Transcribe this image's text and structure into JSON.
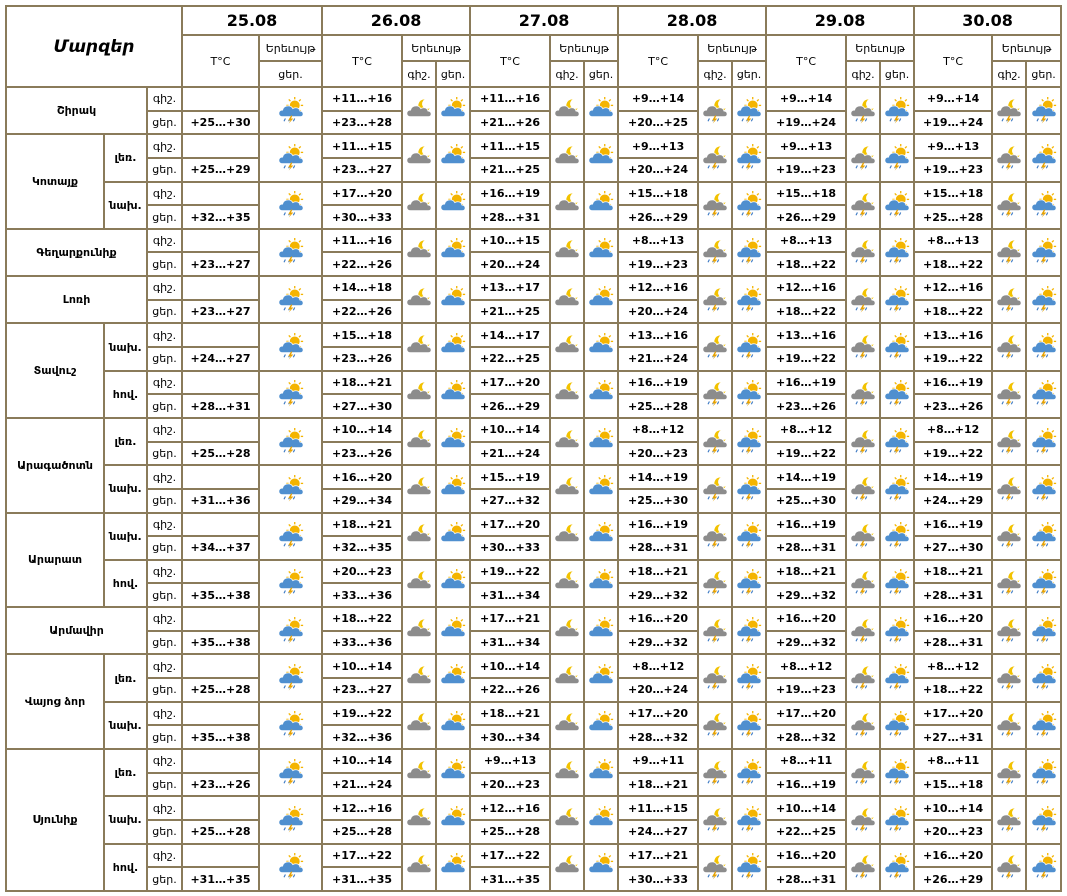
{
  "header": {
    "corner": "Մարզեր",
    "dates": [
      "25.08",
      "26.08",
      "27.08",
      "28.08",
      "29.08",
      "30.08"
    ],
    "temp_label": "T°C",
    "sky_label": "Երեւույթ",
    "night_label": "գիշ.",
    "day_label": "ցեր."
  },
  "regions": [
    {
      "name": "Շիրակ",
      "subs": [
        {
          "name": "",
          "night": [
            "",
            "+11…+16",
            "+11…+16",
            "+9…+14",
            "+9…+14",
            "+9…+14"
          ],
          "day": [
            "+25…+30",
            "+23…+28",
            "+21…+26",
            "+20…+25",
            "+19…+24",
            "+19…+24"
          ]
        }
      ]
    },
    {
      "name": "Կոտայք",
      "subs": [
        {
          "name": "լեռ.",
          "night": [
            "",
            "+11…+15",
            "+11…+15",
            "+9…+13",
            "+9…+13",
            "+9…+13"
          ],
          "day": [
            "+25…+29",
            "+23…+27",
            "+21…+25",
            "+20…+24",
            "+19…+23",
            "+19…+23"
          ]
        },
        {
          "name": "նախ.",
          "night": [
            "",
            "+17…+20",
            "+16…+19",
            "+15…+18",
            "+15…+18",
            "+15…+18"
          ],
          "day": [
            "+32…+35",
            "+30…+33",
            "+28…+31",
            "+26…+29",
            "+26…+29",
            "+25…+28"
          ]
        }
      ]
    },
    {
      "name": "Գեղարքունիք",
      "subs": [
        {
          "name": "",
          "night": [
            "",
            "+11…+16",
            "+10…+15",
            "+8…+13",
            "+8…+13",
            "+8…+13"
          ],
          "day": [
            "+23…+27",
            "+22…+26",
            "+20…+24",
            "+19…+23",
            "+18…+22",
            "+18…+22"
          ]
        }
      ]
    },
    {
      "name": "Լոռի",
      "subs": [
        {
          "name": "",
          "night": [
            "",
            "+14…+18",
            "+13…+17",
            "+12…+16",
            "+12…+16",
            "+12…+16"
          ],
          "day": [
            "+23…+27",
            "+22…+26",
            "+21…+25",
            "+20…+24",
            "+18…+22",
            "+18…+22"
          ]
        }
      ]
    },
    {
      "name": "Տավուշ",
      "subs": [
        {
          "name": "նախ.",
          "night": [
            "",
            "+15…+18",
            "+14…+17",
            "+13…+16",
            "+13…+16",
            "+13…+16"
          ],
          "day": [
            "+24…+27",
            "+23…+26",
            "+22…+25",
            "+21…+24",
            "+19…+22",
            "+19…+22"
          ]
        },
        {
          "name": "հով.",
          "night": [
            "",
            "+18…+21",
            "+17…+20",
            "+16…+19",
            "+16…+19",
            "+16…+19"
          ],
          "day": [
            "+28…+31",
            "+27…+30",
            "+26…+29",
            "+25…+28",
            "+23…+26",
            "+23…+26"
          ]
        }
      ]
    },
    {
      "name": "Արագածոտն",
      "subs": [
        {
          "name": "լեռ.",
          "night": [
            "",
            "+10…+14",
            "+10…+14",
            "+8…+12",
            "+8…+12",
            "+8…+12"
          ],
          "day": [
            "+25…+28",
            "+23…+26",
            "+21…+24",
            "+20…+23",
            "+19…+22",
            "+19…+22"
          ]
        },
        {
          "name": "նախ.",
          "night": [
            "",
            "+16…+20",
            "+15…+19",
            "+14…+19",
            "+14…+19",
            "+14…+19"
          ],
          "day": [
            "+31…+36",
            "+29…+34",
            "+27…+32",
            "+25…+30",
            "+25…+30",
            "+24…+29"
          ]
        }
      ]
    },
    {
      "name": "Արարատ",
      "subs": [
        {
          "name": "նախ.",
          "night": [
            "",
            "+18…+21",
            "+17…+20",
            "+16…+19",
            "+16…+19",
            "+16…+19"
          ],
          "day": [
            "+34…+37",
            "+32…+35",
            "+30…+33",
            "+28…+31",
            "+28…+31",
            "+27…+30"
          ]
        },
        {
          "name": "հով.",
          "night": [
            "",
            "+20…+23",
            "+19…+22",
            "+18…+21",
            "+18…+21",
            "+18…+21"
          ],
          "day": [
            "+35…+38",
            "+33…+36",
            "+31…+34",
            "+29…+32",
            "+29…+32",
            "+28…+31"
          ]
        }
      ]
    },
    {
      "name": "Արմավիր",
      "subs": [
        {
          "name": "",
          "night": [
            "",
            "+18…+22",
            "+17…+21",
            "+16…+20",
            "+16…+20",
            "+16…+20"
          ],
          "day": [
            "+35…+38",
            "+33…+36",
            "+31…+34",
            "+29…+32",
            "+29…+32",
            "+28…+31"
          ]
        }
      ]
    },
    {
      "name": "Վայոց ձոր",
      "subs": [
        {
          "name": "լեռ.",
          "night": [
            "",
            "+10…+14",
            "+10…+14",
            "+8…+12",
            "+8…+12",
            "+8…+12"
          ],
          "day": [
            "+25…+28",
            "+23…+27",
            "+22…+26",
            "+20…+24",
            "+19…+23",
            "+18…+22"
          ]
        },
        {
          "name": "նախ.",
          "night": [
            "",
            "+19…+22",
            "+18…+21",
            "+17…+20",
            "+17…+20",
            "+17…+20"
          ],
          "day": [
            "+35…+38",
            "+32…+36",
            "+30…+34",
            "+28…+32",
            "+28…+32",
            "+27…+31"
          ]
        }
      ]
    },
    {
      "name": "Սյունիք",
      "subs": [
        {
          "name": "լեռ.",
          "night": [
            "",
            "+10…+14",
            "+9…+13",
            "+9…+11",
            "+8…+11",
            "+8…+11"
          ],
          "day": [
            "+23…+26",
            "+21…+24",
            "+20…+23",
            "+18…+21",
            "+16…+19",
            "+15…+18"
          ]
        },
        {
          "name": "նախ.",
          "night": [
            "",
            "+12…+16",
            "+12…+16",
            "+11…+15",
            "+10…+14",
            "+10…+14"
          ],
          "day": [
            "+25…+28",
            "+25…+28",
            "+25…+28",
            "+24…+27",
            "+22…+25",
            "+20…+23"
          ]
        },
        {
          "name": "հով.",
          "night": [
            "",
            "+17…+22",
            "+17…+22",
            "+17…+21",
            "+16…+20",
            "+16…+20"
          ],
          "day": [
            "+31…+35",
            "+31…+35",
            "+31…+35",
            "+30…+33",
            "+28…+31",
            "+26…+29"
          ]
        }
      ]
    }
  ],
  "icons": {
    "day_25": "partly-cloudy-sun-rain-icon",
    "night_default": "cloudy-moon-icon",
    "day_default": "partly-cloudy-sun-icon",
    "night_storm": "cloudy-moon-thunder-icon",
    "day_storm": "partly-cloudy-sun-thunder-icon"
  },
  "colors": {
    "border": "#8a7b5a",
    "cloud_day": "#4f8fcf",
    "cloud_night": "#8c8c8c",
    "sun": "#f4b400",
    "moon": "#f2c200",
    "lightning": "#e8a200",
    "rain": "#3a78c2"
  }
}
